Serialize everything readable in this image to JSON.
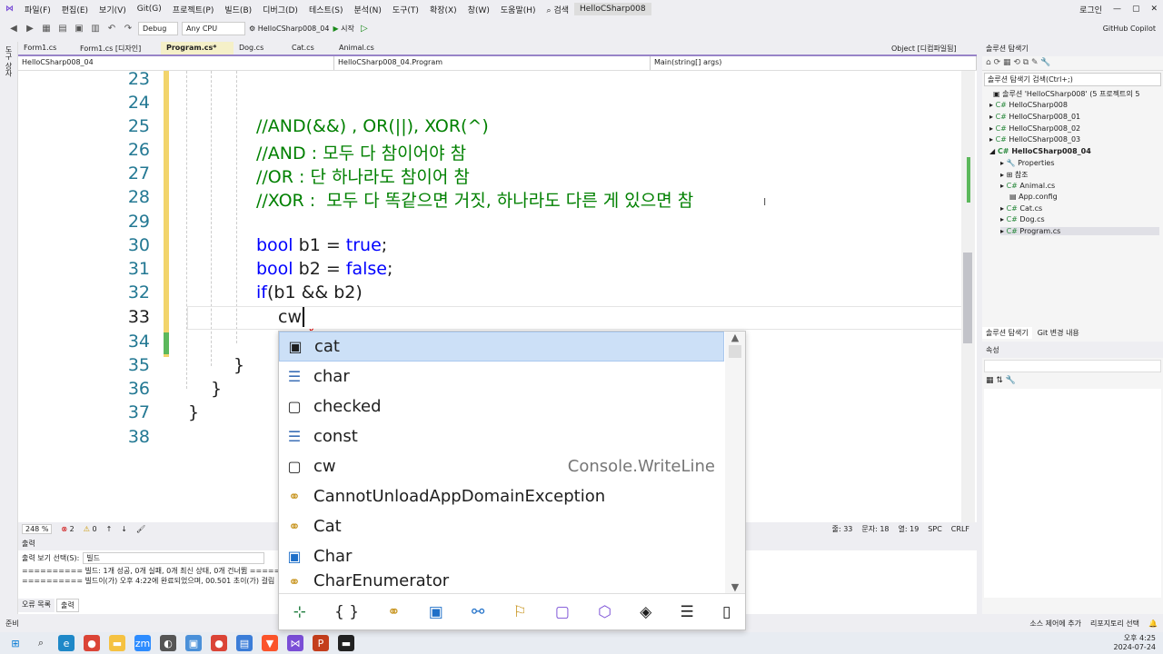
{
  "menu": [
    "파일(F)",
    "편집(E)",
    "보기(V)",
    "Git(G)",
    "프로젝트(P)",
    "빌드(B)",
    "디버그(D)",
    "테스트(S)",
    "분석(N)",
    "도구(T)",
    "확장(X)",
    "창(W)",
    "도움말(H)",
    "검색",
    "HelloCSharp008",
    "로그인",
    "GitHub Copilot"
  ],
  "toolbar": {
    "config": "Debug",
    "platform": "Any CPU",
    "project": "HelloCSharp008_04",
    "start": "시작"
  },
  "tabs": [
    "Form1.cs",
    "Form1.cs [디자인]",
    "Program.cs*",
    "Dog.cs",
    "Cat.cs",
    "Animal.cs",
    "Object [디컴파일됨]"
  ],
  "nav": {
    "project": "HelloCSharp008_04",
    "class": "HelloCSharp008_04.Program",
    "member": "Main(string[] args)"
  },
  "line_numbers": [
    "23",
    "24",
    "25",
    "26",
    "27",
    "28",
    "29",
    "30",
    "31",
    "32",
    "33",
    "34",
    "35",
    "36",
    "37",
    "38"
  ],
  "code": {
    "c1": "//AND(&&) , OR(||), XOR(^)",
    "c2": "//AND : 모두 다 참이어야 참",
    "c3": "//OR : 단 하나라도 참이어 참",
    "c4": "//XOR :  모두 다 똑같으면 거짓, 하나라도 다른 게 있으면 참",
    "l30kw": "bool",
    "l30a": " b1 = ",
    "l30kw2": "true",
    "l30b": ";",
    "l31kw": "bool",
    "l31a": " b2 = ",
    "l31kw2": "false",
    "l31b": ";",
    "l32kw": "if",
    "l32a": "(b1 && b2)",
    "l33": "cw",
    "b35": "}",
    "b36": "}",
    "b37": "}"
  },
  "autocomplete": {
    "items": [
      {
        "label": "cat",
        "icon": "snippet-icon",
        "hint": ""
      },
      {
        "label": "char",
        "icon": "keyword-icon",
        "hint": ""
      },
      {
        "label": "checked",
        "icon": "snippet-icon",
        "hint": ""
      },
      {
        "label": "const",
        "icon": "keyword-icon",
        "hint": ""
      },
      {
        "label": "cw",
        "icon": "snippet-icon",
        "hint": "Console.WriteLine"
      },
      {
        "label": "CannotUnloadAppDomainException",
        "icon": "class-icon",
        "hint": ""
      },
      {
        "label": "Cat",
        "icon": "class-icon",
        "hint": ""
      },
      {
        "label": "Char",
        "icon": "struct-icon",
        "hint": ""
      },
      {
        "label": "CharEnumerator",
        "icon": "class-icon",
        "hint": ""
      }
    ],
    "filter_icons": [
      "{ }",
      "⚭",
      "▣",
      "⚯",
      "⚐",
      "▢",
      "⬡",
      "◈",
      "☰",
      "▯"
    ]
  },
  "editor_status": {
    "zoom": "248 %",
    "errors": "2",
    "warnings": "0",
    "line": "줄: 33",
    "col": "문자: 18",
    "pos": "열: 19",
    "spc": "SPC",
    "crlf": "CRLF"
  },
  "solution": {
    "title": "솔루션 탐색기",
    "search": "솔루션 탐색기 검색(Ctrl+;)",
    "root": "솔루션 'HelloCSharp008' (5 프로젝트의 5",
    "items": [
      "HelloCSharp008",
      "HelloCSharp008_01",
      "HelloCSharp008_02",
      "HelloCSharp008_03",
      "HelloCSharp008_04",
      "Properties",
      "참조",
      "Animal.cs",
      "App.config",
      "Cat.cs",
      "Dog.cs",
      "Program.cs"
    ],
    "tabs": [
      "솔루션 탐색기",
      "Git 변경 내용"
    ]
  },
  "properties": {
    "title": "속성"
  },
  "output": {
    "title": "출력",
    "source_label": "출력 보기 선택(S):",
    "source": "빌드",
    "line1": "========== 빌드: 1개 성공, 0개 실패, 0개 최신 상태, 0개 건너뜀 ==========",
    "line2": "========== 빌드이(가) 오후 4:22에 완료되었으며, 00.501 초이(가) 걸림",
    "tabs": [
      "오류 목록",
      "출력"
    ]
  },
  "statusbar": {
    "ready": "준비",
    "source_control": "소스 제어에 추가",
    "repo": "리포지토리 선택"
  },
  "clock": {
    "time": "오후 4:25",
    "date": "2024-07-24"
  }
}
